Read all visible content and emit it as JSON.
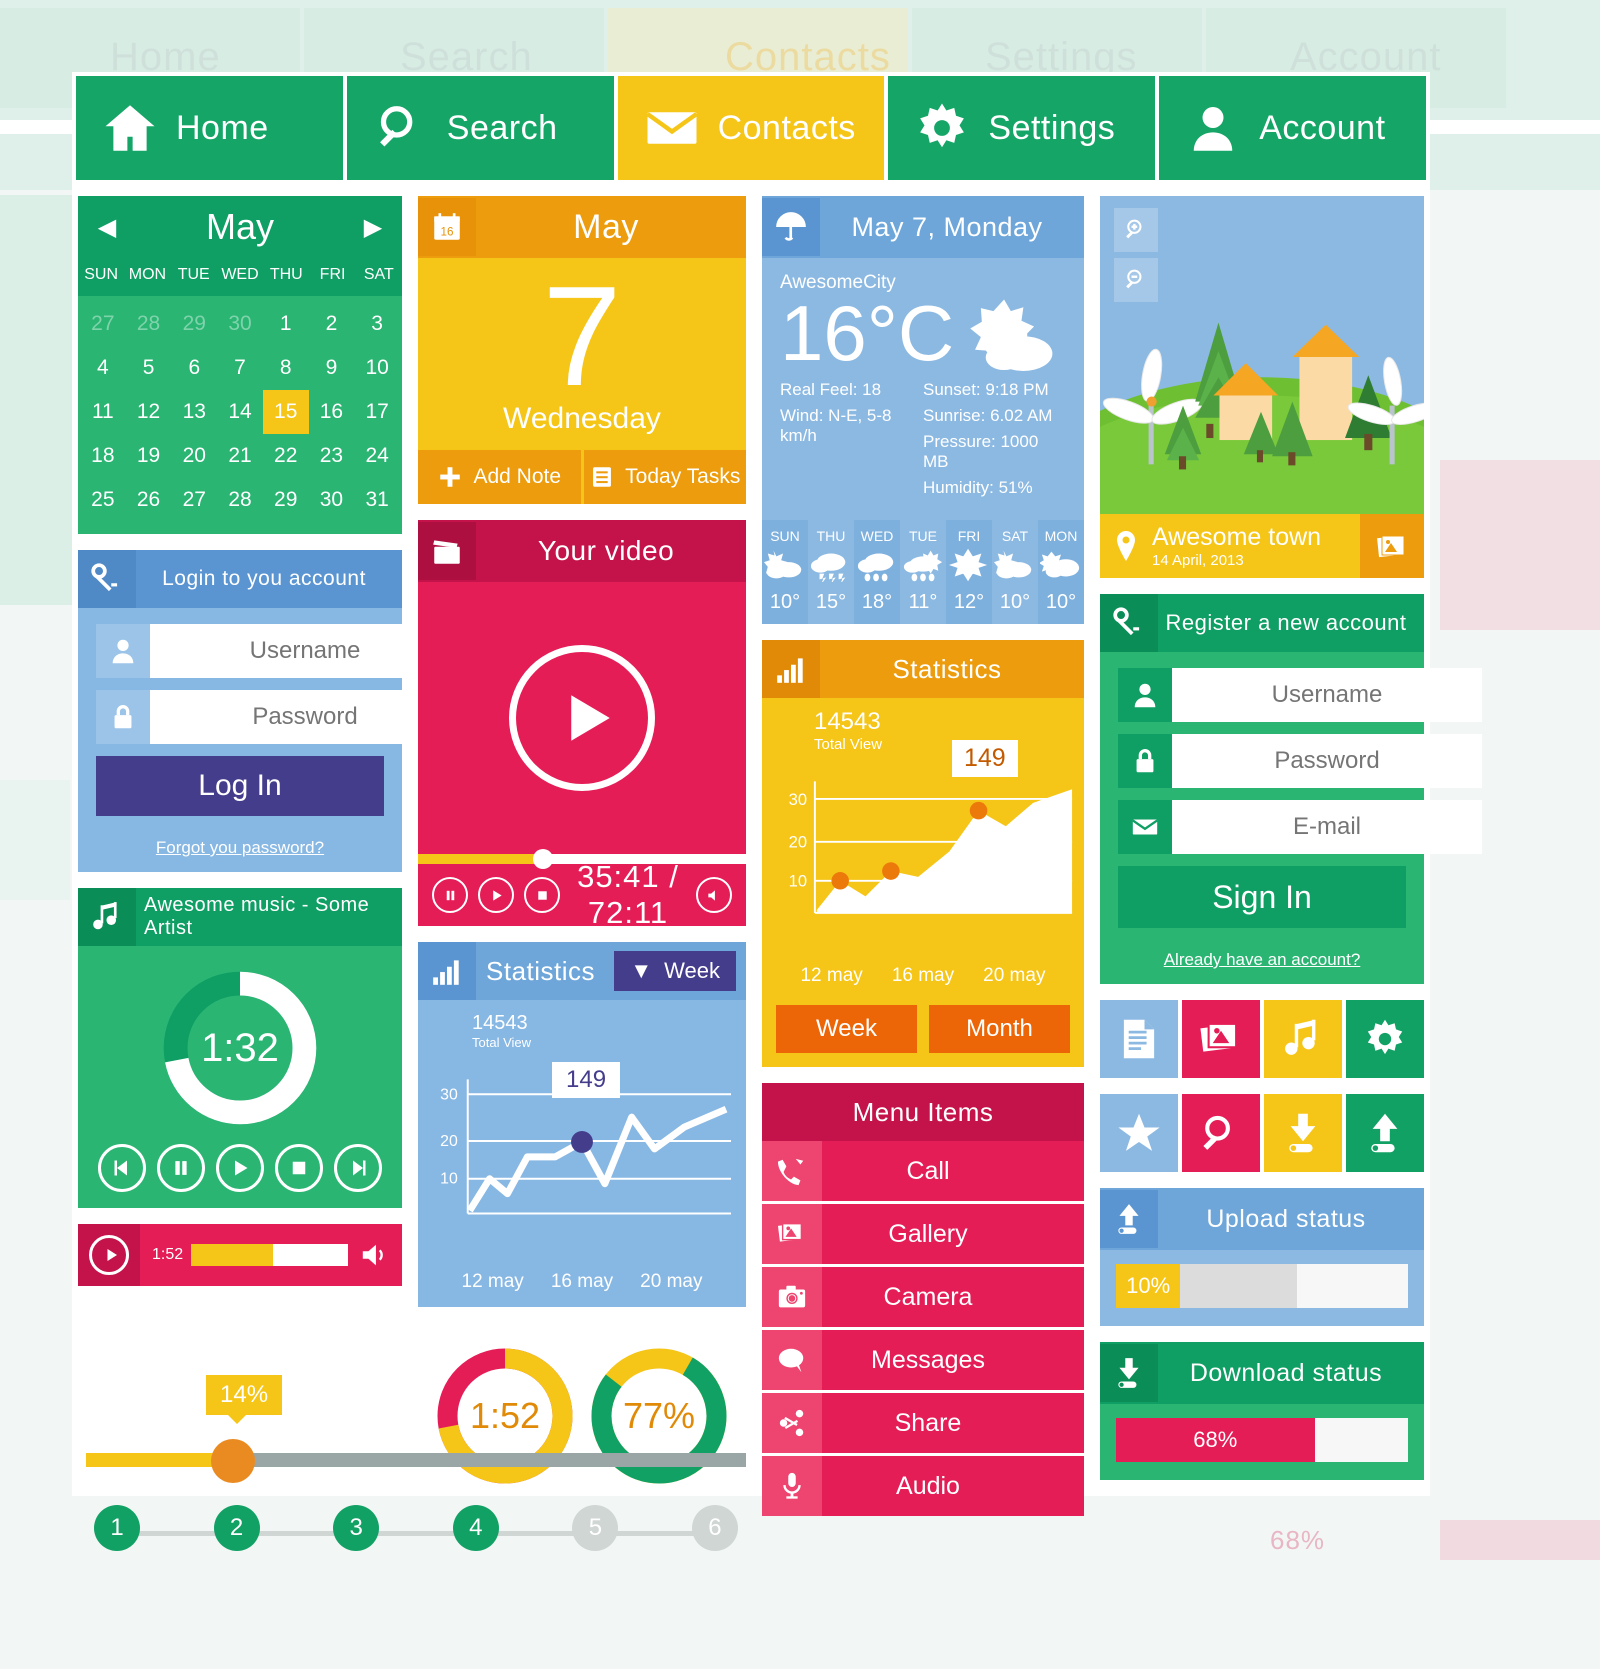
{
  "nav": {
    "items": [
      {
        "label": "Home",
        "icon": "home-icon",
        "color": "#14a567"
      },
      {
        "label": "Search",
        "icon": "search-icon",
        "color": "#14a567"
      },
      {
        "label": "Contacts",
        "icon": "envelope-icon",
        "color": "#f5c518"
      },
      {
        "label": "Settings",
        "icon": "gear-icon",
        "color": "#14a567"
      },
      {
        "label": "Account",
        "icon": "user-icon",
        "color": "#14a567"
      }
    ]
  },
  "calendar": {
    "month": "May",
    "prev_label": "◀",
    "next_label": "▶",
    "dow": [
      "SUN",
      "MON",
      "TUE",
      "WED",
      "THU",
      "FRI",
      "SAT"
    ],
    "days": [
      {
        "n": "27",
        "mut": true
      },
      {
        "n": "28",
        "mut": true
      },
      {
        "n": "29",
        "mut": true
      },
      {
        "n": "30",
        "mut": true
      },
      {
        "n": "1"
      },
      {
        "n": "2"
      },
      {
        "n": "3"
      },
      {
        "n": "4"
      },
      {
        "n": "5"
      },
      {
        "n": "6"
      },
      {
        "n": "7"
      },
      {
        "n": "8"
      },
      {
        "n": "9"
      },
      {
        "n": "10"
      },
      {
        "n": "11"
      },
      {
        "n": "12"
      },
      {
        "n": "13"
      },
      {
        "n": "14"
      },
      {
        "n": "15",
        "sel": true
      },
      {
        "n": "16"
      },
      {
        "n": "17"
      },
      {
        "n": "18"
      },
      {
        "n": "19"
      },
      {
        "n": "20"
      },
      {
        "n": "21"
      },
      {
        "n": "22"
      },
      {
        "n": "23"
      },
      {
        "n": "24"
      },
      {
        "n": "25"
      },
      {
        "n": "26"
      },
      {
        "n": "27"
      },
      {
        "n": "28"
      },
      {
        "n": "29"
      },
      {
        "n": "30"
      },
      {
        "n": "31"
      }
    ]
  },
  "day_card": {
    "header": "May",
    "icon": "calendar-16-icon",
    "number": "7",
    "weekday": "Wednesday",
    "add_note": "Add Note",
    "today_tasks": "Today Tasks"
  },
  "login": {
    "title": "Login to you account",
    "icon": "key-icon",
    "username_placeholder": "Username",
    "password_placeholder": "Password",
    "submit": "Log In",
    "forgot": "Forgot you password?"
  },
  "music": {
    "title": "Awesome music - Some Artist",
    "icon": "music-note-icon",
    "time": "1:32",
    "progress_percent": 72,
    "controls": [
      "prev-icon",
      "pause-icon",
      "play-icon",
      "stop-icon",
      "next-icon"
    ]
  },
  "video": {
    "title": "Your video",
    "icon": "video-clapper-icon",
    "time": "35:41 / 72:11",
    "progress_percent": 38,
    "controls": [
      "pause-icon",
      "play-icon",
      "stop-icon"
    ],
    "volume_icon": "speaker-icon"
  },
  "stats_blue": {
    "title": "Statistics",
    "icon": "bar-chart-icon",
    "range_label": "Week",
    "range_caret": "▼",
    "total_value": "14543",
    "total_label": "Total View",
    "tooltip": "149"
  },
  "audio_bar": {
    "time": "1:52",
    "progress_percent": 52,
    "play_icon": "play-icon",
    "speaker_icon": "speaker-icon"
  },
  "slider": {
    "tooltip": "14%",
    "value_percent": 14
  },
  "steps": [
    {
      "n": "1",
      "on": true
    },
    {
      "n": "2",
      "on": true
    },
    {
      "n": "3",
      "on": true
    },
    {
      "n": "4",
      "on": true
    },
    {
      "n": "5",
      "on": false
    },
    {
      "n": "6",
      "on": false
    }
  ],
  "donuts": [
    {
      "label": "1:52",
      "value_percent": 72,
      "color": "#f5c518",
      "rest": "#e51d57"
    },
    {
      "label": "77%",
      "value_percent": 77,
      "color": "#12a164",
      "rest": "#f5c518"
    }
  ],
  "weather": {
    "title": "May 7, Monday",
    "icon": "umbrella-icon",
    "city": "AwesomeCity",
    "temp": "16°C",
    "real_feel": "Real Feel: 18",
    "wind": "Wind: N-E, 5-8 km/h",
    "sunset": "Sunset: 9:18 PM",
    "sunrise": "Sunrise: 6.02 AM",
    "pressure": "Pressure: 1000 MB",
    "humidity": "Humidity: 51%",
    "forecast": [
      {
        "day": "SUN",
        "temp": "10°",
        "icon": "sun-cloud-icon"
      },
      {
        "day": "THU",
        "temp": "15°",
        "icon": "thunder-icon"
      },
      {
        "day": "WED",
        "temp": "18°",
        "icon": "rain-icon"
      },
      {
        "day": "TUE",
        "temp": "11°",
        "icon": "sun-rain-icon"
      },
      {
        "day": "FRI",
        "temp": "12°",
        "icon": "sun-icon"
      },
      {
        "day": "SAT",
        "temp": "10°",
        "icon": "sun-cloud-icon"
      },
      {
        "day": "MON",
        "temp": "10°",
        "icon": "cloud-icon"
      }
    ]
  },
  "stats_yellow": {
    "title": "Statistics",
    "icon": "bar-chart-icon",
    "total_value": "14543",
    "total_label": "Total View",
    "tooltip": "149",
    "btn_week": "Week",
    "btn_month": "Month"
  },
  "menu": {
    "title": "Menu Items",
    "items": [
      {
        "label": "Call",
        "icon": "phone-icon"
      },
      {
        "label": "Gallery",
        "icon": "gallery-icon"
      },
      {
        "label": "Camera",
        "icon": "camera-icon"
      },
      {
        "label": "Messages",
        "icon": "chat-bubble-icon"
      },
      {
        "label": "Share",
        "icon": "share-icon"
      },
      {
        "label": "Audio",
        "icon": "microphone-icon"
      }
    ]
  },
  "photo": {
    "zoom_in_icon": "zoom-in-icon",
    "zoom_out_icon": "zoom-out-icon",
    "place": "Awesome town",
    "date": "14 April, 2013",
    "pin_icon": "map-pin-icon",
    "action_icon": "gallery-icon"
  },
  "register": {
    "title": "Register a new account",
    "icon": "key-icon",
    "username_placeholder": "Username",
    "password_placeholder": "Password",
    "email_placeholder": "E-mail",
    "submit": "Sign In",
    "already": "Already have an account?"
  },
  "icon_grid_1": [
    {
      "icon": "document-icon",
      "color": "#8cb9e2"
    },
    {
      "icon": "gallery-icon",
      "color": "#e51d57"
    },
    {
      "icon": "music-note-icon",
      "color": "#f5c518"
    },
    {
      "icon": "gear-icon",
      "color": "#12a164"
    }
  ],
  "icon_grid_2": [
    {
      "icon": "star-icon",
      "color": "#8cb9e2"
    },
    {
      "icon": "search-icon",
      "color": "#e51d57"
    },
    {
      "icon": "download-icon",
      "color": "#f5c518"
    },
    {
      "icon": "upload-icon",
      "color": "#12a164"
    }
  ],
  "upload": {
    "title": "Upload status",
    "icon": "upload-icon",
    "percent_label": "10%",
    "percent": 10
  },
  "download": {
    "title": "Download status",
    "icon": "download-icon",
    "percent_label": "68%",
    "percent": 68
  },
  "chart_data": [
    {
      "type": "line",
      "title": "Statistics",
      "x": [
        "12 may",
        "16 may",
        "20 may"
      ],
      "xlabel": "",
      "ylabel": "",
      "ylim": [
        0,
        33
      ],
      "yticks": [
        10,
        20,
        30
      ],
      "values": [
        1,
        8,
        4,
        13,
        13,
        18,
        12,
        26,
        18,
        25,
        28
      ],
      "annotation": {
        "label": "149",
        "index": 5,
        "value": 18
      },
      "total_value": 14543,
      "total_label": "Total View",
      "grid": true,
      "legend": "none",
      "theme": "blue"
    },
    {
      "type": "area",
      "title": "Statistics",
      "x": [
        "12 may",
        "16 may",
        "20 may"
      ],
      "xlabel": "",
      "ylabel": "",
      "ylim": [
        0,
        33
      ],
      "yticks": [
        10,
        20,
        30
      ],
      "values": [
        0,
        7,
        4,
        14,
        12,
        25,
        22,
        28,
        27,
        32
      ],
      "annotation": {
        "label": "149",
        "index": 5,
        "value": 25
      },
      "markers": [
        {
          "index": 1,
          "value": 7
        },
        {
          "index": 3,
          "value": 14
        },
        {
          "index": 5,
          "value": 25
        }
      ],
      "total_value": 14543,
      "total_label": "Total View",
      "grid": true,
      "legend": "none",
      "theme": "yellow"
    }
  ]
}
